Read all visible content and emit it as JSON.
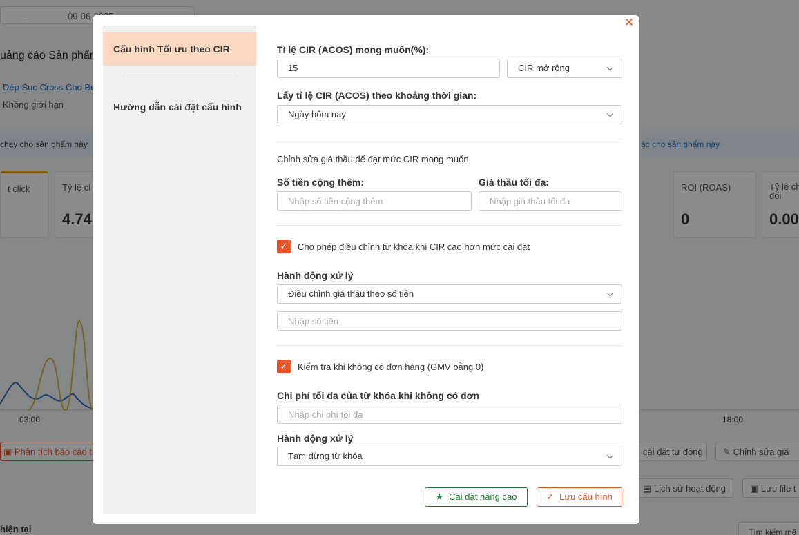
{
  "background": {
    "date_from": "-",
    "date_to": "09-06-2025",
    "title": "uảng cáo Sản phẩm",
    "product": "Dép Sục Cross Cho Bé",
    "limit": "Không giới hạn",
    "banner_left": "chạy cho sản phẩm này.",
    "banner_right": "ác cho sản phẩm này",
    "cards": [
      {
        "label": "t click",
        "value": ""
      },
      {
        "label": "Tỷ lệ cl",
        "value": "4.74"
      },
      {
        "label": "ROI (ROAS)",
        "value": "0"
      },
      {
        "label": "Tỷ lệ ch đổi",
        "value": "0.00"
      }
    ],
    "x_ticks": [
      "03:00",
      "18:00"
    ],
    "btn_analysis": "Phân tích báo cáo tự",
    "btn_auto": "cài đặt tự động",
    "btn_edit": "Chỉnh sửa giá",
    "btn_history": "Lịch sử hoạt động",
    "btn_save_file": "Lưu file t",
    "now": "hiện tại",
    "search": "Tìm kiếm mã"
  },
  "modal": {
    "close_icon": "close-icon",
    "sidebar": {
      "items": [
        {
          "label": "Cấu hình Tối ưu theo CIR",
          "active": true
        },
        {
          "label": "Hướng dẫn cài đặt cấu hình",
          "active": false
        }
      ]
    },
    "form": {
      "cir_label": "Tỉ lệ CIR (ACOS) mong muốn(%):",
      "cir_value": "15",
      "cir_mode": "CIR mở rộng",
      "period_label": "Lấy tỉ lệ CIR (ACOS) theo khoảng thời gian:",
      "period_value": "Ngày hôm nay",
      "bid_section": "Chỉnh sửa giá thầu để đạt mức CIR mong muốn",
      "extra_label": "Số tiền cộng thêm:",
      "extra_placeholder": "Nhập số tiền cộng thêm",
      "maxbid_label": "Giá thầu tối đa:",
      "maxbid_placeholder": "Nhập giá thầu tối đa",
      "allow_adjust_label": "Cho phép điều chỉnh từ khóa khi CIR cao hơn mức cài đặt",
      "action1_label": "Hành động xử lý",
      "action1_value": "Điều chỉnh giá thầu theo số tiền",
      "amount_placeholder": "Nhập số tiền",
      "check_no_order_label": "Kiểm tra khi không có đơn hàng (GMV bằng 0)",
      "max_cost_label": "Chi phí tối đa của từ khóa khi không có đơn",
      "max_cost_placeholder": "Nhập chi phí tối đa",
      "action2_label": "Hành động xử lý",
      "action2_value": "Tạm dừng từ khóa",
      "advanced_button": "Cài đặt nâng cao",
      "save_button": "Lưu cấu hình"
    }
  },
  "colors": {
    "accent": "#e8552a",
    "green": "#1e7a2e",
    "sidebar_active": "#fbd8bf"
  }
}
